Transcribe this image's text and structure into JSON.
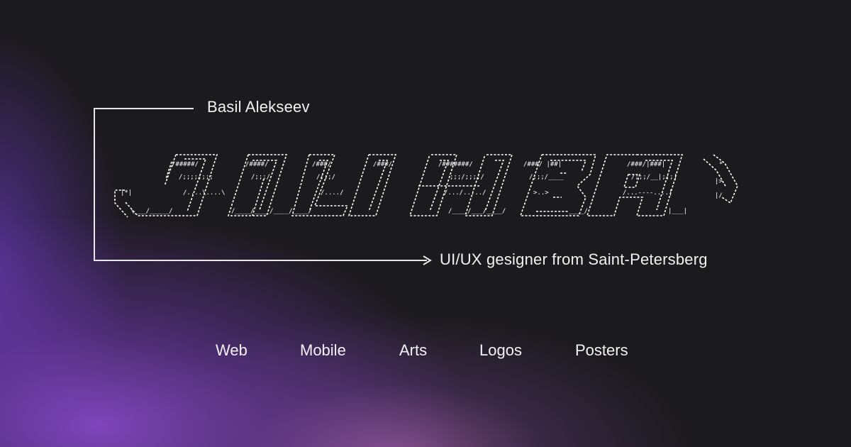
{
  "author": {
    "name": "Basil Alekseev",
    "tagline": "UI/UX gesigner from Saint-Petersberg"
  },
  "logo": {
    "icon": "ascii-art-logo",
    "color": "#ffffff"
  },
  "nav": {
    "items": [
      "Web",
      "Mobile",
      "Arts",
      "Logos",
      "Posters"
    ]
  },
  "colors": {
    "background": "#1b1a1d",
    "text": "#f2f2f4",
    "glow_primary": "#7a44c4",
    "glow_secondary": "#be6ec8"
  }
}
